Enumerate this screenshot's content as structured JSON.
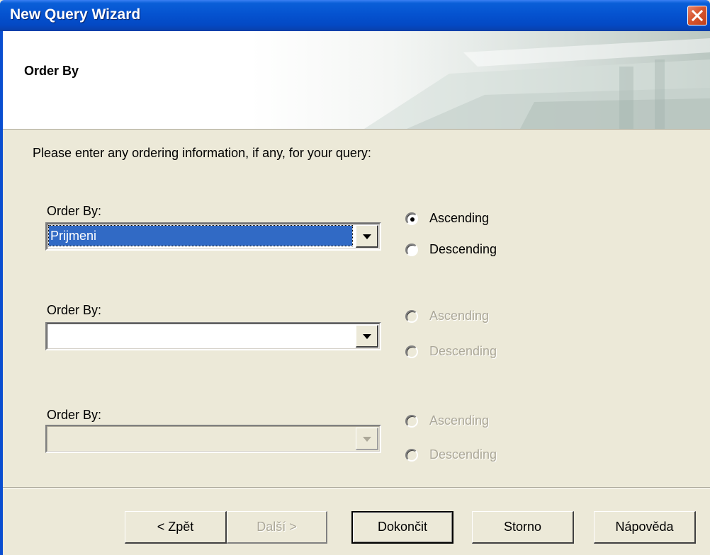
{
  "window": {
    "title": "New Query Wizard"
  },
  "header": {
    "title": "Order By"
  },
  "instructions": "Please enter any ordering information, if any, for your query:",
  "order_groups": [
    {
      "label": "Order By:",
      "value": "Prijmeni",
      "enabled": true,
      "ascending_label": "Ascending",
      "descending_label": "Descending",
      "direction": "ascending"
    },
    {
      "label": "Order By:",
      "value": "",
      "enabled": true,
      "ascending_label": "Ascending",
      "descending_label": "Descending",
      "direction": "none"
    },
    {
      "label": "Order By:",
      "value": "",
      "enabled": false,
      "ascending_label": "Ascending",
      "descending_label": "Descending",
      "direction": "none"
    }
  ],
  "buttons": {
    "back": "< Zpět",
    "next": "Další >",
    "finish": "Dokončit",
    "cancel": "Storno",
    "help": "Nápověda"
  },
  "icons": {
    "close": "close-icon",
    "dropdown": "chevron-down-icon"
  },
  "colors": {
    "titlebar": "#0553d0",
    "close": "#d6552e",
    "selection": "#316ac5",
    "face": "#ece9d8"
  }
}
